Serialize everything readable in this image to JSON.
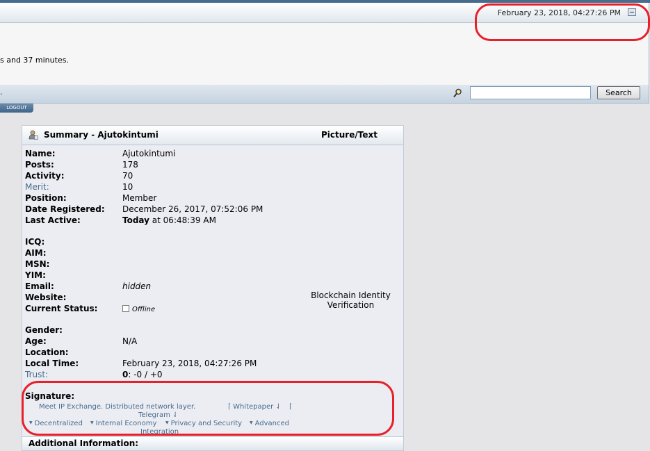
{
  "header": {
    "datetime": "February 23, 2018, 04:27:26 PM",
    "info_text": "s and 37 minutes.",
    "dot": ".",
    "search_placeholder": "",
    "search_button": "Search",
    "logout": "LOGOUT"
  },
  "summary": {
    "title": "Summary - Ajutokintumi",
    "picture_text": "Picture/Text",
    "fields": {
      "name_label": "Name:",
      "name": "Ajutokintumi",
      "posts_label": "Posts:",
      "posts": "178",
      "activity_label": "Activity:",
      "activity": "70",
      "merit_label": "Merit:",
      "merit": "10",
      "position_label": "Position:",
      "position": "Member",
      "registered_label": "Date Registered:",
      "registered": "December 26, 2017, 07:52:06 PM",
      "last_active_label": "Last Active:",
      "last_active_bold": "Today",
      "last_active_rest": " at 06:48:39 AM",
      "icq_label": "ICQ:",
      "aim_label": "AIM:",
      "msn_label": "MSN:",
      "yim_label": "YIM:",
      "email_label": "Email:",
      "email": "hidden",
      "website_label": "Website:",
      "status_label": "Current Status:",
      "status": "Offline",
      "gender_label": "Gender:",
      "age_label": "Age:",
      "age": "N/A",
      "location_label": "Location:",
      "local_time_label": "Local Time:",
      "local_time": "February 23, 2018, 04:27:26 PM",
      "trust_label": "Trust:",
      "trust_bold": "0",
      "trust_rest": ": -0 / +0"
    },
    "blockchain_line1": "Blockchain Identity",
    "blockchain_line2": "Verification",
    "signature_label": "Signature:",
    "signature": {
      "line1": "Meet IP Exchange. Distributed network layer.",
      "whitepaper": "⌈ Whitepaper ⇃",
      "telegram_open": "⌈",
      "telegram": "Telegram ⇃",
      "items": [
        "Decentralized",
        "Internal Economy",
        "Privacy and Security",
        "Advanced"
      ],
      "cut": "Integration"
    },
    "additional": "Additional Information:"
  },
  "colors": {
    "accent": "#476c8e",
    "highlight": "#e8202a"
  }
}
